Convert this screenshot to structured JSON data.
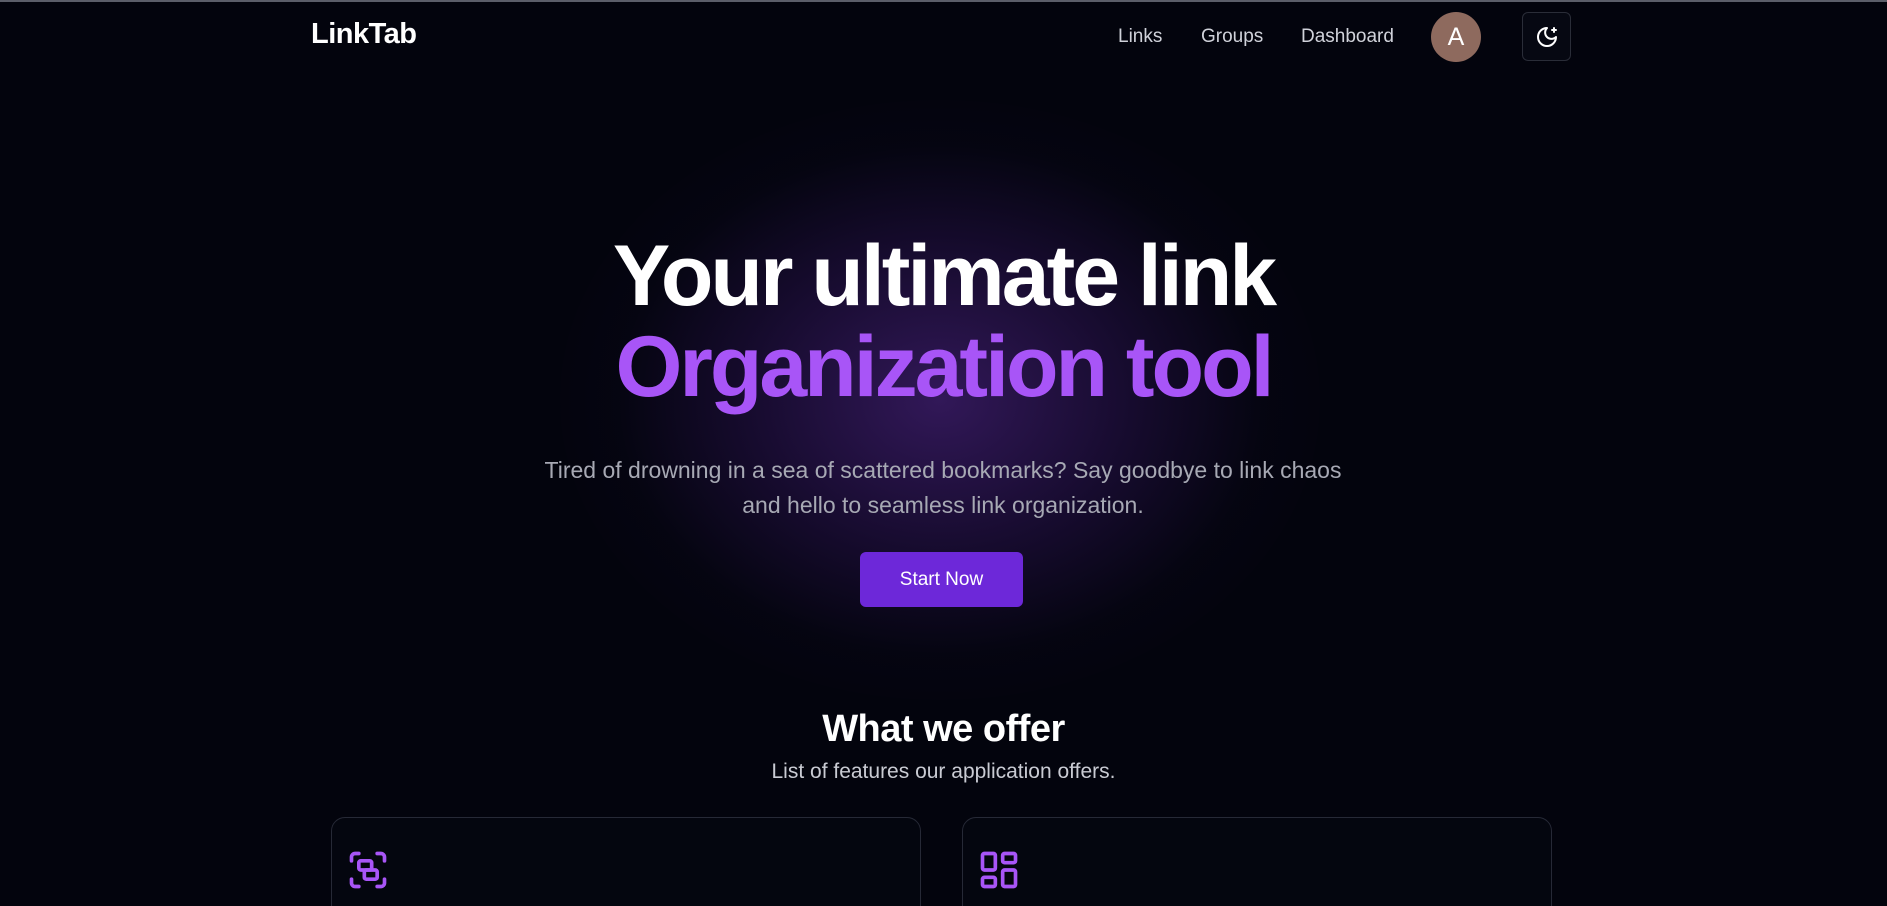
{
  "nav": {
    "brand": "LinkTab",
    "links": [
      "Links",
      "Groups",
      "Dashboard"
    ],
    "avatar_initial": "A",
    "theme_toggle_icon": "moon-sparkle-icon"
  },
  "hero": {
    "title_line_1": "Your ultimate link",
    "title_line_2": "Organization tool",
    "subtitle_line_1": "Tired of drowning in a sea of scattered bookmarks? Say goodbye to link chaos",
    "subtitle_line_2": "and hello to seamless link organization.",
    "cta_label": "Start Now"
  },
  "features": {
    "title": "What we offer",
    "subtitle": "List of features our application offers.",
    "cards": [
      {
        "icon": "group-links-icon"
      },
      {
        "icon": "layout-dashboard-icon"
      }
    ]
  },
  "colors": {
    "background": "#03040d",
    "accent": "#a855f7",
    "button": "#6d28d9",
    "avatar": "#8e6a5e",
    "muted_text": "#a7a9b4"
  }
}
